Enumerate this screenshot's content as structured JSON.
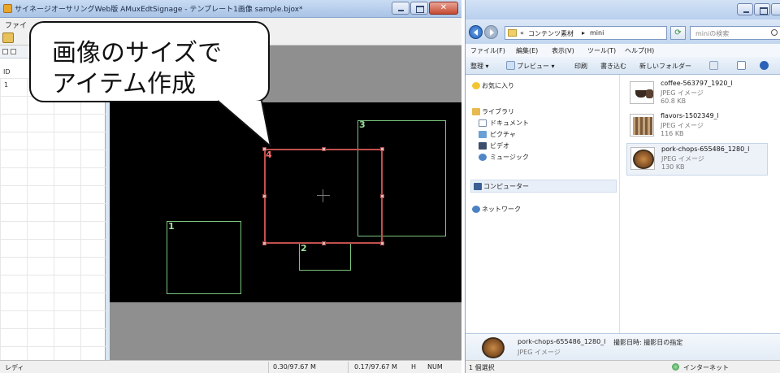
{
  "editor": {
    "title": "サイネージオーサリングWeb版 AMuxEdtSignage - テンプレート1画像 sample.bjox*",
    "menu_label": "ファイ",
    "list": {
      "col_header": "ID",
      "row_value": "1"
    },
    "items": [
      {
        "label": "1",
        "selected": false
      },
      {
        "label": "2",
        "selected": false
      },
      {
        "label": "3",
        "selected": false
      },
      {
        "label": "4",
        "selected": true
      }
    ],
    "status": {
      "ready": "レディ",
      "memory_1": "0.30/97.67 M",
      "memory_2": "0.17/97.67 M",
      "mode": "H",
      "numlock": "NUM"
    },
    "colors": {
      "canvas": "#000000",
      "item_border": "#7bc47f",
      "selected_border": "#c0504d"
    }
  },
  "callout": {
    "line1": "画像のサイズで",
    "line2": "アイテム作成"
  },
  "explorer": {
    "address": {
      "prefix": "«",
      "folder": "コンテンツ素材",
      "arrow": "▸",
      "current": "mini"
    },
    "search_placeholder": "miniの検索",
    "menu": [
      "ファイル(F)",
      "編集(E)",
      "表示(V)",
      "ツール(T)",
      "ヘルプ(H)"
    ],
    "commands": [
      "整理 ▾",
      "プレビュー ▾",
      "印刷",
      "書き込む",
      "新しいフォルダー"
    ],
    "nav": {
      "favorites": "お気に入り",
      "library": "ライブラリ",
      "documents": "ドキュメント",
      "pictures": "ピクチャ",
      "videos": "ビデオ",
      "music": "ミュージック",
      "computer": "コンピューター",
      "network": "ネットワーク"
    },
    "files": [
      {
        "name": "coffee-563797_1920_l",
        "type": "JPEG イメージ",
        "size": "60.8 KB"
      },
      {
        "name": "flavors-1502349_l",
        "type": "JPEG イメージ",
        "size": "116 KB"
      },
      {
        "name": "pork-chops-655486_1280_l",
        "type": "JPEG イメージ",
        "size": "130 KB"
      }
    ],
    "details": {
      "name": "pork-chops-655486_1280_l",
      "date_label": "撮影日時: 撮影日の指定",
      "type": "JPEG イメージ"
    },
    "status": {
      "selection": "1 個選択",
      "zone": "インターネット"
    }
  }
}
